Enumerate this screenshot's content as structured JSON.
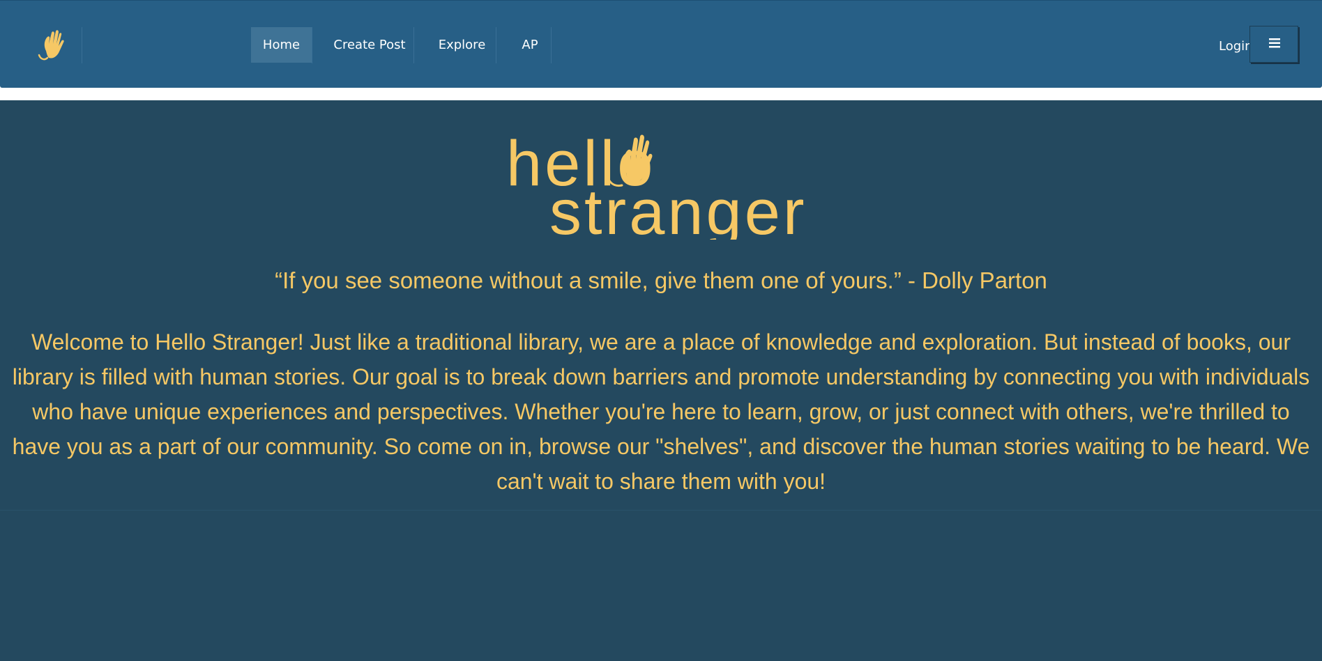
{
  "nav": {
    "items": [
      {
        "label": "Home",
        "active": true
      },
      {
        "label": "Create Post",
        "active": false
      },
      {
        "label": "Explore",
        "active": false
      },
      {
        "label": "AP",
        "active": false
      }
    ],
    "login_label": "Login",
    "menu_icon": "hamburger-icon",
    "logo_icon": "waving-hand-icon"
  },
  "hero": {
    "logo_line1": "hello",
    "logo_line2": "stranger",
    "quote": "“If you see someone without a smile, give them one of yours.” - Dolly Parton",
    "welcome": "Welcome to Hello Stranger! Just like a traditional library, we are a place of knowledge and exploration. But instead of books, our library is filled with human stories. Our goal is to break down barriers and promote understanding by connecting you with individuals who have unique experiences and perspectives. Whether you're here to learn, grow, or just connect with others, we're thrilled to have you as a part of our community. So come on in, browse our \"shelves\", and discover the human stories waiting to be heard. We can't wait to share them with you!"
  },
  "colors": {
    "navbar": "#275f86",
    "background": "#24495f",
    "accent": "#f6c865",
    "nav_active": "#3f7396"
  }
}
